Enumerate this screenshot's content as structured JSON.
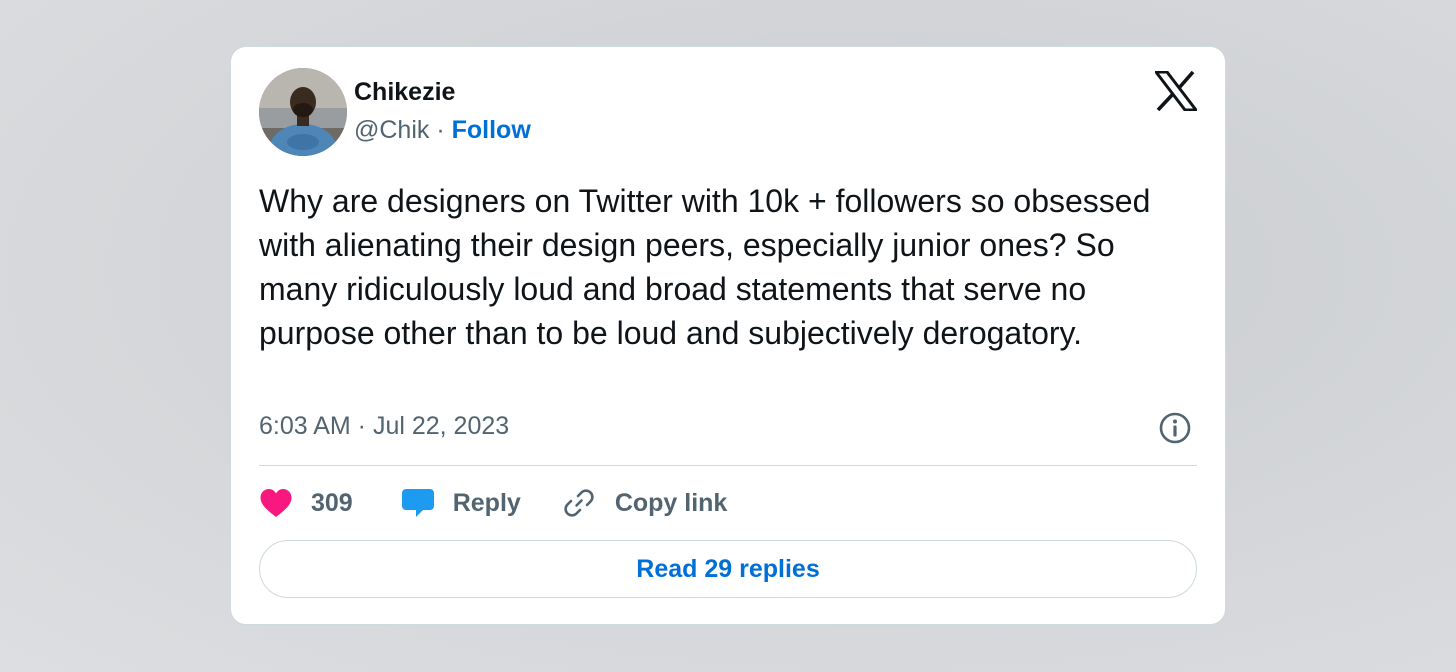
{
  "author": {
    "name": "Chikezie",
    "handle": "@Chik",
    "separator": "·",
    "follow_label": "Follow"
  },
  "tweet": {
    "text": "Why are designers on Twitter with 10k + followers so obsessed with alienating their design peers, especially junior ones? So many ridiculously loud and broad statements that serve no purpose other than to be loud and subjectively derogatory.",
    "timestamp": "6:03 AM · Jul 22, 2023"
  },
  "actions": {
    "like_count": "309",
    "reply_label": "Reply",
    "copy_label": "Copy link"
  },
  "read_replies_label": "Read 29 replies",
  "icons": {
    "brand": "x-logo-icon",
    "info": "info-icon",
    "like": "heart-icon",
    "reply": "speech-bubble-icon",
    "copy": "link-icon"
  },
  "colors": {
    "link": "#006fd6",
    "heart": "#f91880",
    "reply_bubble": "#1d9bf0",
    "text": "#0f1419",
    "muted": "#536471",
    "border": "#cfd9de"
  }
}
